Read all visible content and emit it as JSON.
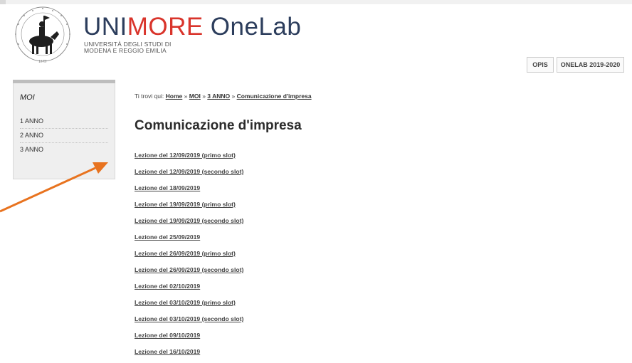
{
  "header": {
    "brand_uni": "UNI",
    "brand_more": "MORE",
    "brand_onelab": "OneLab",
    "subtitle_line1": "UNIVERSITÀ DEGLI STUDI DI",
    "subtitle_line2": "MODENA E REGGIO EMILIA",
    "seal_text": "1175",
    "nav": [
      "OPIS",
      "ONELAB 2019-2020"
    ]
  },
  "sidebar": {
    "title": "MOI",
    "items": [
      "1 ANNO",
      "2 ANNO",
      "3 ANNO"
    ]
  },
  "breadcrumb": {
    "prefix": "Ti trovi qui:",
    "items": [
      "Home",
      "MOI",
      "3 ANNO",
      "Comunicazione d'impresa"
    ],
    "separator": "»"
  },
  "page": {
    "title": "Comunicazione d'impresa",
    "lessons": [
      "Lezione del 12/09/2019 (primo slot)",
      "Lezione del 12/09/2019 (secondo slot)",
      "Lezione del 18/09/2019",
      "Lezione del 19/09/2019 (primo slot)",
      "Lezione del 19/09/2019 (secondo slot)",
      "Lezione del 25/09/2019",
      "Lezione del 26/09/2019 (primo slot)",
      "Lezione del 26/09/2019 (secondo slot)",
      "Lezione del 02/10/2019",
      "Lezione del 03/10/2019 (primo slot)",
      "Lezione del 03/10/2019 (secondo slot)",
      "Lezione del 09/10/2019",
      "Lezione del 16/10/2019"
    ]
  },
  "colors": {
    "brand_navy": "#2c3d5c",
    "brand_red": "#d9342b",
    "annotation_arrow": "#e8731f"
  }
}
